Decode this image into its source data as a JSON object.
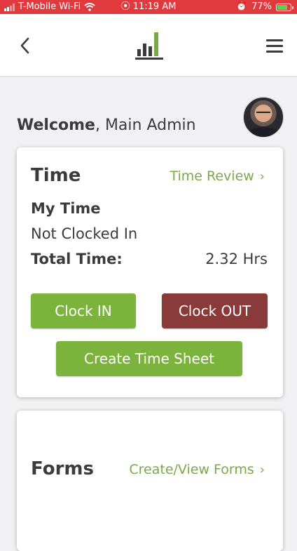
{
  "status_bar": {
    "carrier": "T-Mobile Wi-Fi",
    "time": "11:19 AM",
    "battery": "77%",
    "background_color": "#e0393e"
  },
  "navbar": {
    "back_icon": "chevron-left-icon",
    "logo_icon": "bar-chart-logo",
    "menu_icon": "hamburger-menu-icon"
  },
  "welcome": {
    "greeting": "Welcome",
    "name": ", Main Admin"
  },
  "time_card": {
    "title": "Time",
    "review_link": "Time Review",
    "my_time_label": "My Time",
    "status": "Not Clocked In",
    "total_label": "Total Time:",
    "total_value": "2.32 Hrs",
    "clock_in_label": "Clock IN",
    "clock_out_label": "Clock OUT",
    "create_sheet_label": "Create Time Sheet"
  },
  "forms_card": {
    "title": "Forms",
    "link": "Create/View Forms"
  },
  "colors": {
    "accent_green": "#79a94a",
    "button_green": "#7bb33d",
    "button_red": "#8b3a3a"
  }
}
